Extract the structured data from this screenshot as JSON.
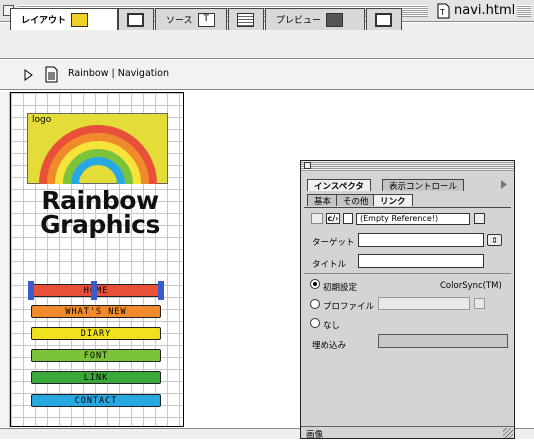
{
  "window": {
    "title": "navi.html"
  },
  "tabs": [
    {
      "label": "レイアウト",
      "active": true
    },
    {
      "label": "ソース",
      "active": false
    },
    {
      "label": "プレビュー",
      "active": false
    }
  ],
  "toolbar": {
    "breadcrumb": "Rainbow | Navigation"
  },
  "page": {
    "logo_label": "logo",
    "brand_line1": "Rainbow",
    "brand_line2": "Graphics",
    "nav": [
      {
        "label": "HOME",
        "color": "#e8503a"
      },
      {
        "label": "WHAT'S NEW",
        "color": "#f08a2a"
      },
      {
        "label": "DIARY",
        "color": "#f0e21e"
      },
      {
        "label": "FONT",
        "color": "#7cc33c"
      },
      {
        "label": "LINK",
        "color": "#3aa83a"
      },
      {
        "label": "CONTACT",
        "color": "#28a8e0"
      }
    ]
  },
  "inspector": {
    "tabs": [
      "インスペクタ",
      "表示コントロール"
    ],
    "subtabs": [
      "基本",
      "その他",
      "リンク"
    ],
    "link_value": "(Empty Reference!)",
    "target_label": "ターゲット",
    "title_label": "タイトル",
    "color": {
      "initial_label": "初期設定",
      "initial_value": "ColorSync(TM)",
      "profile_label": "プロファイル",
      "none_label": "なし"
    },
    "embed_label": "埋め込み",
    "footer_label": "画像"
  }
}
